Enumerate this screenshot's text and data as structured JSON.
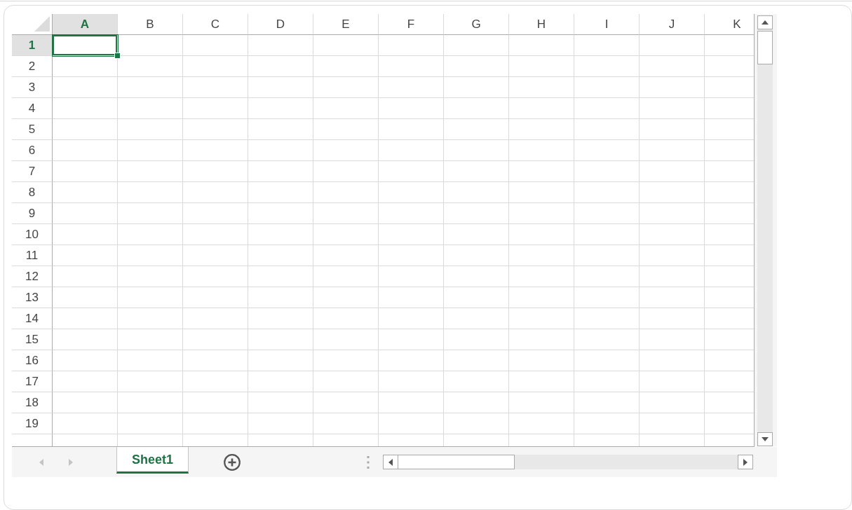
{
  "spreadsheet": {
    "columns": [
      {
        "label": "A",
        "selected": true
      },
      {
        "label": "B",
        "selected": false
      },
      {
        "label": "C",
        "selected": false
      },
      {
        "label": "D",
        "selected": false
      },
      {
        "label": "E",
        "selected": false
      },
      {
        "label": "F",
        "selected": false
      },
      {
        "label": "G",
        "selected": false
      },
      {
        "label": "H",
        "selected": false
      },
      {
        "label": "I",
        "selected": false
      },
      {
        "label": "J",
        "selected": false
      },
      {
        "label": "K",
        "selected": false
      }
    ],
    "rows": [
      {
        "label": "1",
        "selected": true
      },
      {
        "label": "2",
        "selected": false
      },
      {
        "label": "3",
        "selected": false
      },
      {
        "label": "4",
        "selected": false
      },
      {
        "label": "5",
        "selected": false
      },
      {
        "label": "6",
        "selected": false
      },
      {
        "label": "7",
        "selected": false
      },
      {
        "label": "8",
        "selected": false
      },
      {
        "label": "9",
        "selected": false
      },
      {
        "label": "10",
        "selected": false
      },
      {
        "label": "11",
        "selected": false
      },
      {
        "label": "12",
        "selected": false
      },
      {
        "label": "13",
        "selected": false
      },
      {
        "label": "14",
        "selected": false
      },
      {
        "label": "15",
        "selected": false
      },
      {
        "label": "16",
        "selected": false
      },
      {
        "label": "17",
        "selected": false
      },
      {
        "label": "18",
        "selected": false
      },
      {
        "label": "19",
        "selected": false
      }
    ]
  },
  "sheet_nav": [
    {
      "kind": "previous",
      "disabled": true
    },
    {
      "kind": "next",
      "disabled": true
    }
  ],
  "sheet_tabs": [
    {
      "label": "Sheet1",
      "selected": true
    }
  ]
}
